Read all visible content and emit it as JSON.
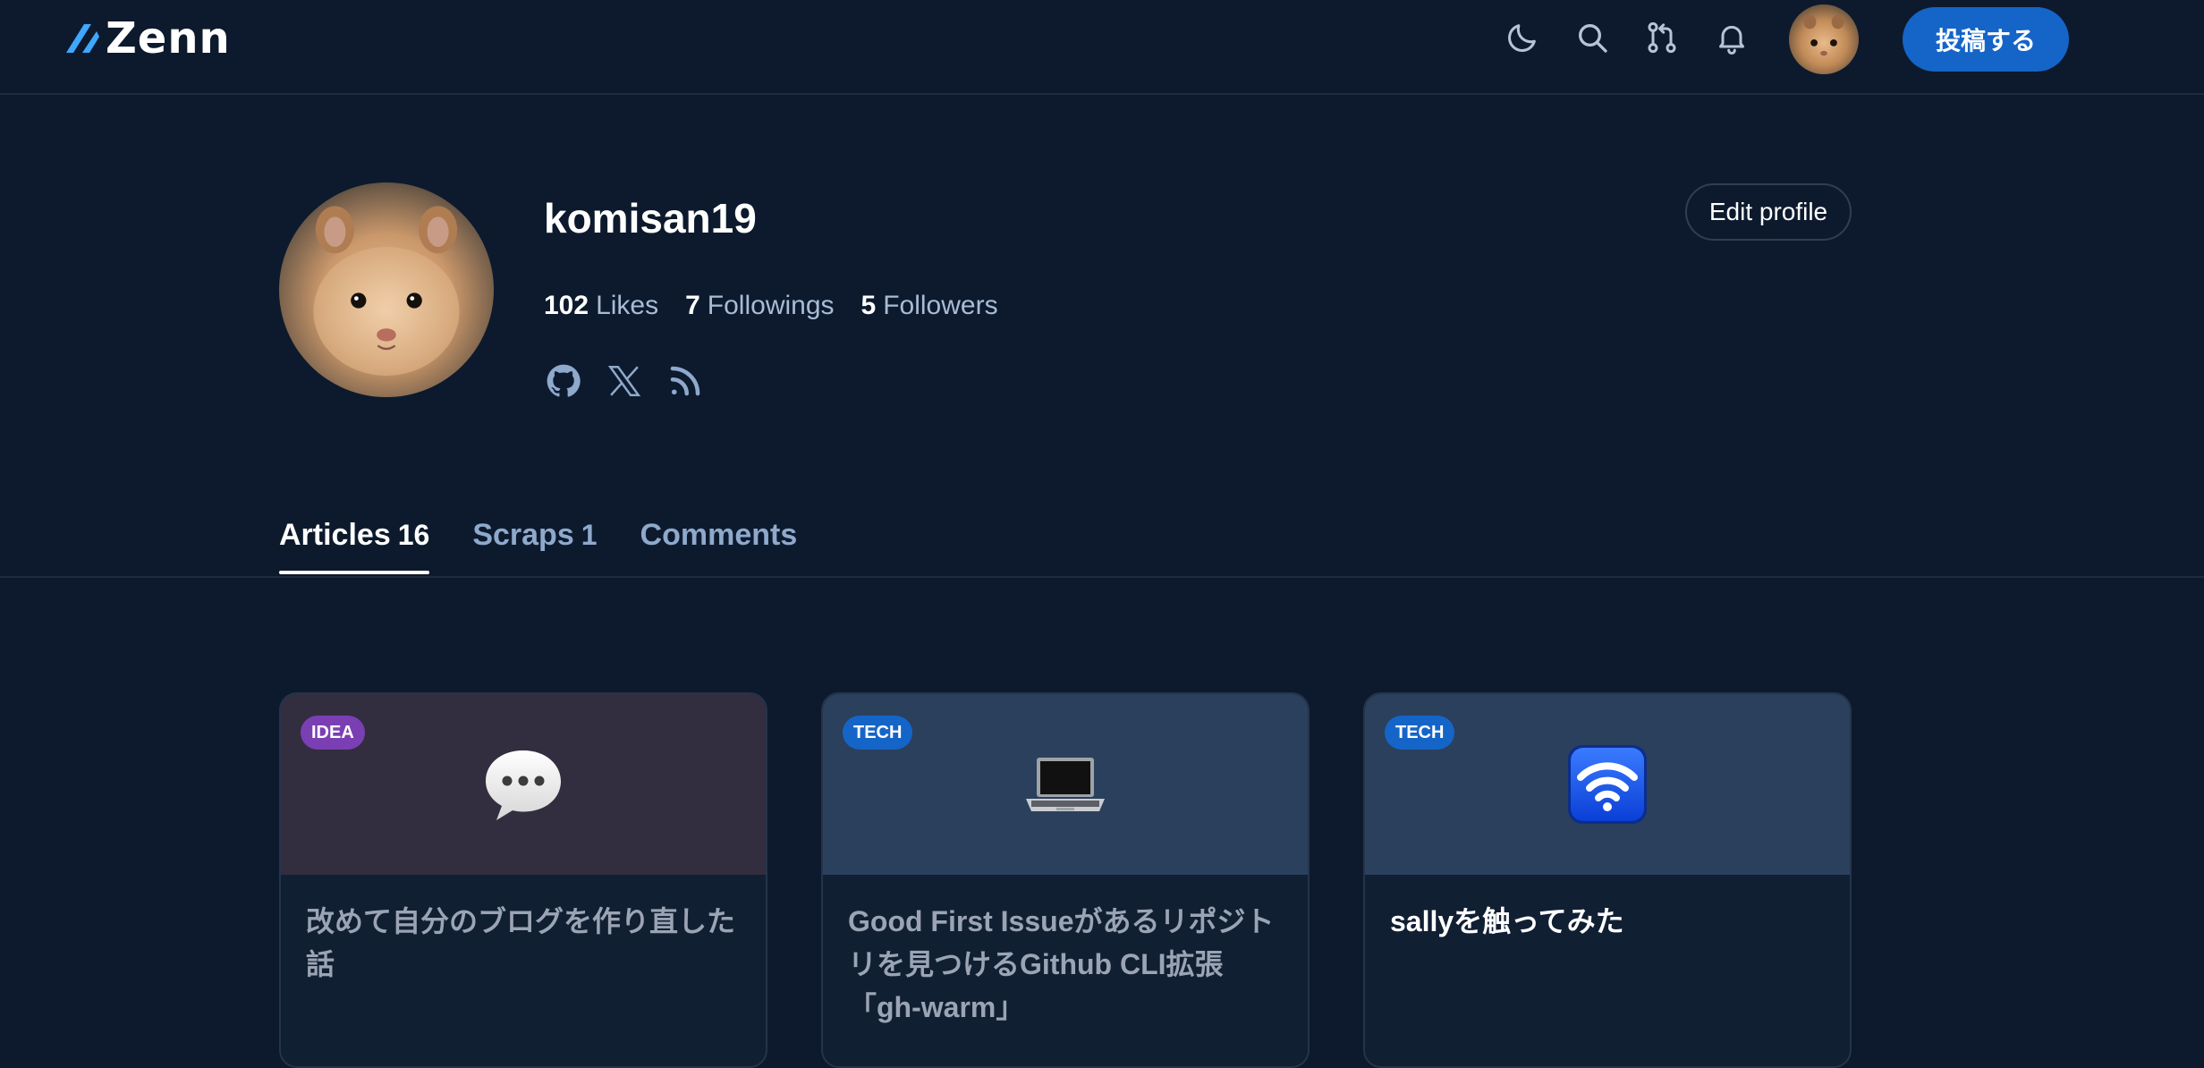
{
  "header": {
    "logo_text": "Zenn",
    "icons": [
      "moon-icon",
      "search-icon",
      "pull-request-icon",
      "bell-icon"
    ],
    "post_button_label": "投稿する",
    "accent_color": "#1565c8"
  },
  "profile": {
    "username": "komisan19",
    "stats": [
      {
        "value": "102",
        "label": "Likes"
      },
      {
        "value": "7",
        "label": "Followings"
      },
      {
        "value": "5",
        "label": "Followers"
      }
    ],
    "social_icons": [
      "github-icon",
      "x-icon",
      "rss-icon"
    ],
    "edit_label": "Edit profile"
  },
  "tabs": [
    {
      "label": "Articles",
      "count": "16",
      "active": true
    },
    {
      "label": "Scraps",
      "count": "1",
      "active": false
    },
    {
      "label": "Comments",
      "count": "",
      "active": false
    }
  ],
  "articles": [
    {
      "badge": "IDEA",
      "emoji": "speech-balloon-icon",
      "title": "改めて自分のブログを作り直した話"
    },
    {
      "badge": "TECH",
      "emoji": "laptop-icon",
      "title": "Good First Issueがあるリポジトリを見つけるGithub CLI拡張「gh-warm」"
    },
    {
      "badge": "TECH",
      "emoji": "wifi-icon",
      "title": "sallyを触ってみた"
    }
  ]
}
